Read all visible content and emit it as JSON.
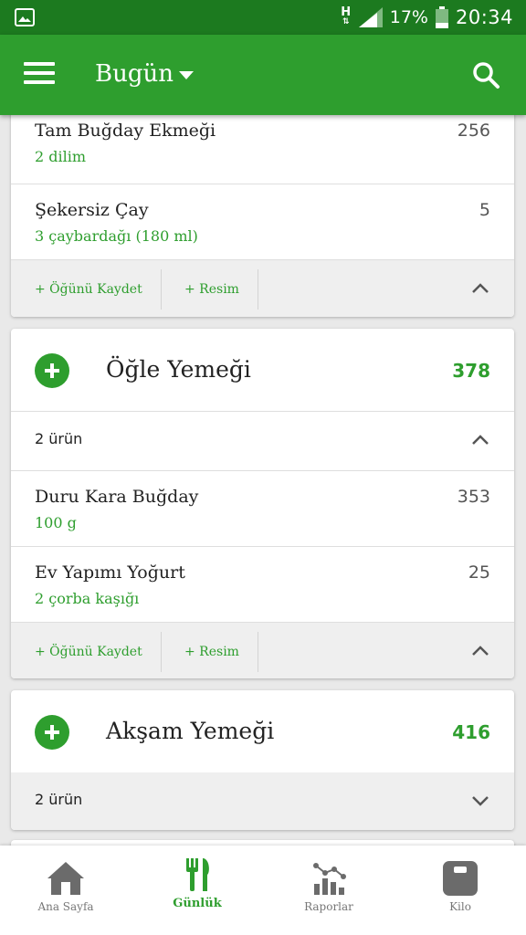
{
  "status_bar": {
    "network_type": "H",
    "battery_percent": "17%",
    "time": "20:34",
    "icons": [
      "gallery-icon",
      "signal-icon",
      "battery-icon"
    ]
  },
  "app_bar": {
    "title": "Bugün",
    "icons": [
      "menu-icon",
      "dropdown-icon",
      "search-icon"
    ]
  },
  "breakfast": {
    "items": [
      {
        "name": "Tam Buğday Ekmeği",
        "quantity": "2 dilim",
        "calories": "256"
      },
      {
        "name": "Şekersiz Çay",
        "quantity": "3  çaybardağı (180 ml)",
        "calories": "5"
      }
    ],
    "actions": {
      "save_meal": "+ Öğünü Kaydet",
      "photo": "+ Resim"
    }
  },
  "lunch": {
    "name": "Öğle Yemeği",
    "calories": "378",
    "count": "2 ürün",
    "items": [
      {
        "name": "Duru Kara Buğday",
        "quantity": "100 g",
        "calories": "353"
      },
      {
        "name": "Ev Yapımı Yoğurt",
        "quantity": "2  çorba kaşığı",
        "calories": "25"
      }
    ],
    "actions": {
      "save_meal": "+ Öğünü Kaydet",
      "photo": "+ Resim"
    }
  },
  "dinner": {
    "name": "Akşam Yemeği",
    "calories": "416",
    "count": "2 ürün"
  },
  "bottom_nav": {
    "items": [
      {
        "label": "Ana Sayfa",
        "icon": "home-icon"
      },
      {
        "label": "Günlük",
        "icon": "cutlery-icon",
        "active": true
      },
      {
        "label": "Raporlar",
        "icon": "reports-icon"
      },
      {
        "label": "Kilo",
        "icon": "scale-icon"
      }
    ]
  },
  "colors": {
    "primary": "#2e9e2e",
    "status_bar": "#1c7a1f",
    "background": "#e9e9e9",
    "action_bar": "#efefef"
  }
}
